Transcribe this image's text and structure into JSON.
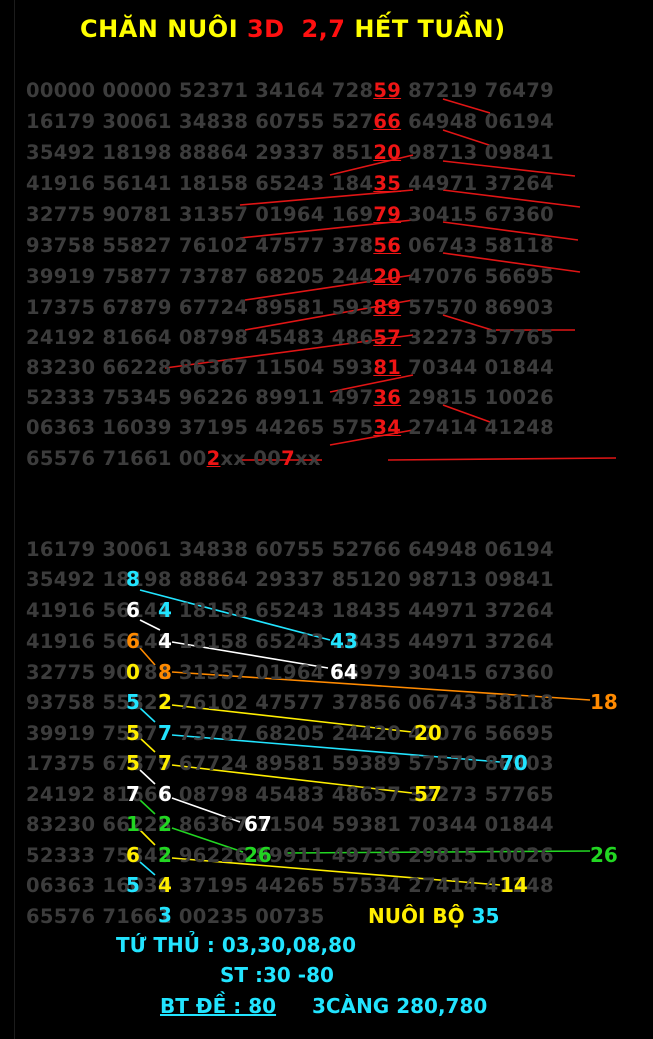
{
  "title": {
    "part1": "CHĂN NUÔI",
    "part2": "3D",
    "part3": "2,7",
    "part4": "HẾT TUẦN)"
  },
  "table1": {
    "rows": [
      [
        "00000 00000 52371 34164 728",
        "59",
        " 87219 76479"
      ],
      [
        "16179 30061 34838 60755 527",
        "66",
        " 64948 06194"
      ],
      [
        "35492 18198 88864 29337 851",
        "20",
        " 98713 09841"
      ],
      [
        "41916 56141 18158 65243 184",
        "35",
        " 44971 37264"
      ],
      [
        "32775 90781 31357 01964 169",
        "79",
        " 30415 67360"
      ],
      [
        "93758 55827 76102 47577 378",
        "56",
        " 06743 58118"
      ],
      [
        "39919 75877 73787 68205 244",
        "20",
        " 47076 56695"
      ],
      [
        "17375 67879 67724 89581 593",
        "89",
        " 57570 86903"
      ],
      [
        "24192 81664 08798 45483 486",
        "57",
        " 32273 57765"
      ],
      [
        "83230 66228 86367 11504 593",
        "81",
        " 70344 01844"
      ],
      [
        "52333 75345 96226 89911 497",
        "36",
        " 29815 10026"
      ],
      [
        "06363 16039 37195 44265 575",
        "34",
        " 27414 41248"
      ]
    ],
    "last_row": [
      "65576 71661 00",
      "2",
      "xx 00",
      "7",
      "xx"
    ]
  },
  "table2": {
    "rows": [
      "16179 30061 34838 60755 52766 64948 06194",
      "35492 18198 88864 29337 85120 98713 09841",
      "41916 56141 18158 65243 18435 44971 37264",
      "41916 56141 18158 65243 18435 44971 37264",
      "32775 90781 31357 01964 16979 30415 67360",
      "93758 55827 76102 47577 37856 06743 58118",
      "39919 75877 73787 68205 24420 47076 56695",
      "17375 67879 67724 89581 59389 57570 86903",
      "24192 81664 08798 45483 48657 32273 57765",
      "83230 66228 86367 11504 59381 70344 01844",
      "52333 75345 96226 89911 49736 29815 10026",
      "06363 16039 37195 44265 57534 27414 41248",
      "65576 71661 00235 00735"
    ],
    "annotations": {
      "a1": "8",
      "a2": "6",
      "a3": "4",
      "a4": "43",
      "a5": "6",
      "a6": "4",
      "a7": "0",
      "a8": "8",
      "a9": "64",
      "a10": "5",
      "a11": "2",
      "a12": "18",
      "a13": "5",
      "a14": "7",
      "a15": "20",
      "a16": "5",
      "a17": "7",
      "a18": "70",
      "a19": "7",
      "a20": "6",
      "a21": "57",
      "a22": "1",
      "a23": "2",
      "a24": "67",
      "a25": "6",
      "a26": "2",
      "a27": "26",
      "a28": "26",
      "a29": "5",
      "a30": "4",
      "a31": "14",
      "a32": "3"
    }
  },
  "bottom": {
    "nuoi_bo": "NUÔI BỘ",
    "nuoi_bo_value": "35",
    "tu_thu": "TỨ THỦ :  03,30,08,80",
    "st": "ST :30 -80",
    "bt_de": "BT ĐỀ : 80",
    "ba_cang": "3CÀNG 280,780"
  },
  "colors": {
    "background": "#000000",
    "faded_digits": "#3c3c3c",
    "highlight_red": "#ee1515",
    "title_yellow": "#ffff00",
    "cyan": "#22e4ff"
  }
}
